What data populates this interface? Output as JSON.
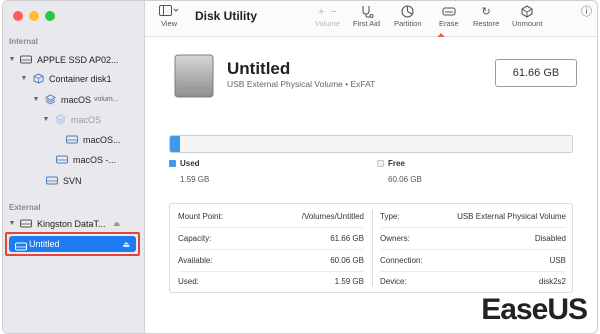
{
  "window": {
    "title": "Disk Utility"
  },
  "sidebar": {
    "sections": {
      "internal": "Internal",
      "external": "External"
    },
    "items": [
      {
        "label": "APPLE SSD AP02..."
      },
      {
        "label": "Container disk1"
      },
      {
        "label": "macOS",
        "suffix": "volum..."
      },
      {
        "label": "macOS"
      },
      {
        "label": "macOS..."
      },
      {
        "label": "macOS -..."
      },
      {
        "label": "SVN"
      },
      {
        "label": "Kingston DataT..."
      },
      {
        "label": "Untitled"
      }
    ],
    "eject_icon": "⏏"
  },
  "toolbar": {
    "view_label": "View",
    "volume_label": "Volume",
    "first_aid_label": "First Aid",
    "partition_label": "Partition",
    "erase_label": "Erase",
    "restore_label": "Restore",
    "unmount_label": "Unmount",
    "icons": {
      "view": "sidebar-icon",
      "volume": "plus-minus-icon",
      "first_aid": "stethoscope-icon",
      "partition": "pie-icon",
      "erase": "erase-icon",
      "restore": "restore-icon",
      "unmount": "unmount-icon"
    }
  },
  "volume": {
    "name": "Untitled",
    "description": "USB External Physical Volume • ExFAT",
    "capacity_display": "61.66 GB"
  },
  "usage": {
    "used_label": "Used",
    "used_value": "1.59 GB",
    "free_label": "Free",
    "free_value": "60.06 GB",
    "used_fraction": 0.026,
    "used_color": "#3b9bea",
    "free_color": "#f1f1f1"
  },
  "info": {
    "left": [
      {
        "key": "Mount Point:",
        "value": "/Volumes/Untitled"
      },
      {
        "key": "Capacity:",
        "value": "61.66 GB"
      },
      {
        "key": "Available:",
        "value": "60.06 GB"
      },
      {
        "key": "Used:",
        "value": "1.59 GB"
      }
    ],
    "right": [
      {
        "key": "Type:",
        "value": "USB External Physical Volume"
      },
      {
        "key": "Owners:",
        "value": "Disabled"
      },
      {
        "key": "Connection:",
        "value": "USB"
      },
      {
        "key": "Device:",
        "value": "disk2s2"
      }
    ]
  },
  "brand": {
    "text": "EaseUS",
    "color": "#1f5fd6"
  }
}
